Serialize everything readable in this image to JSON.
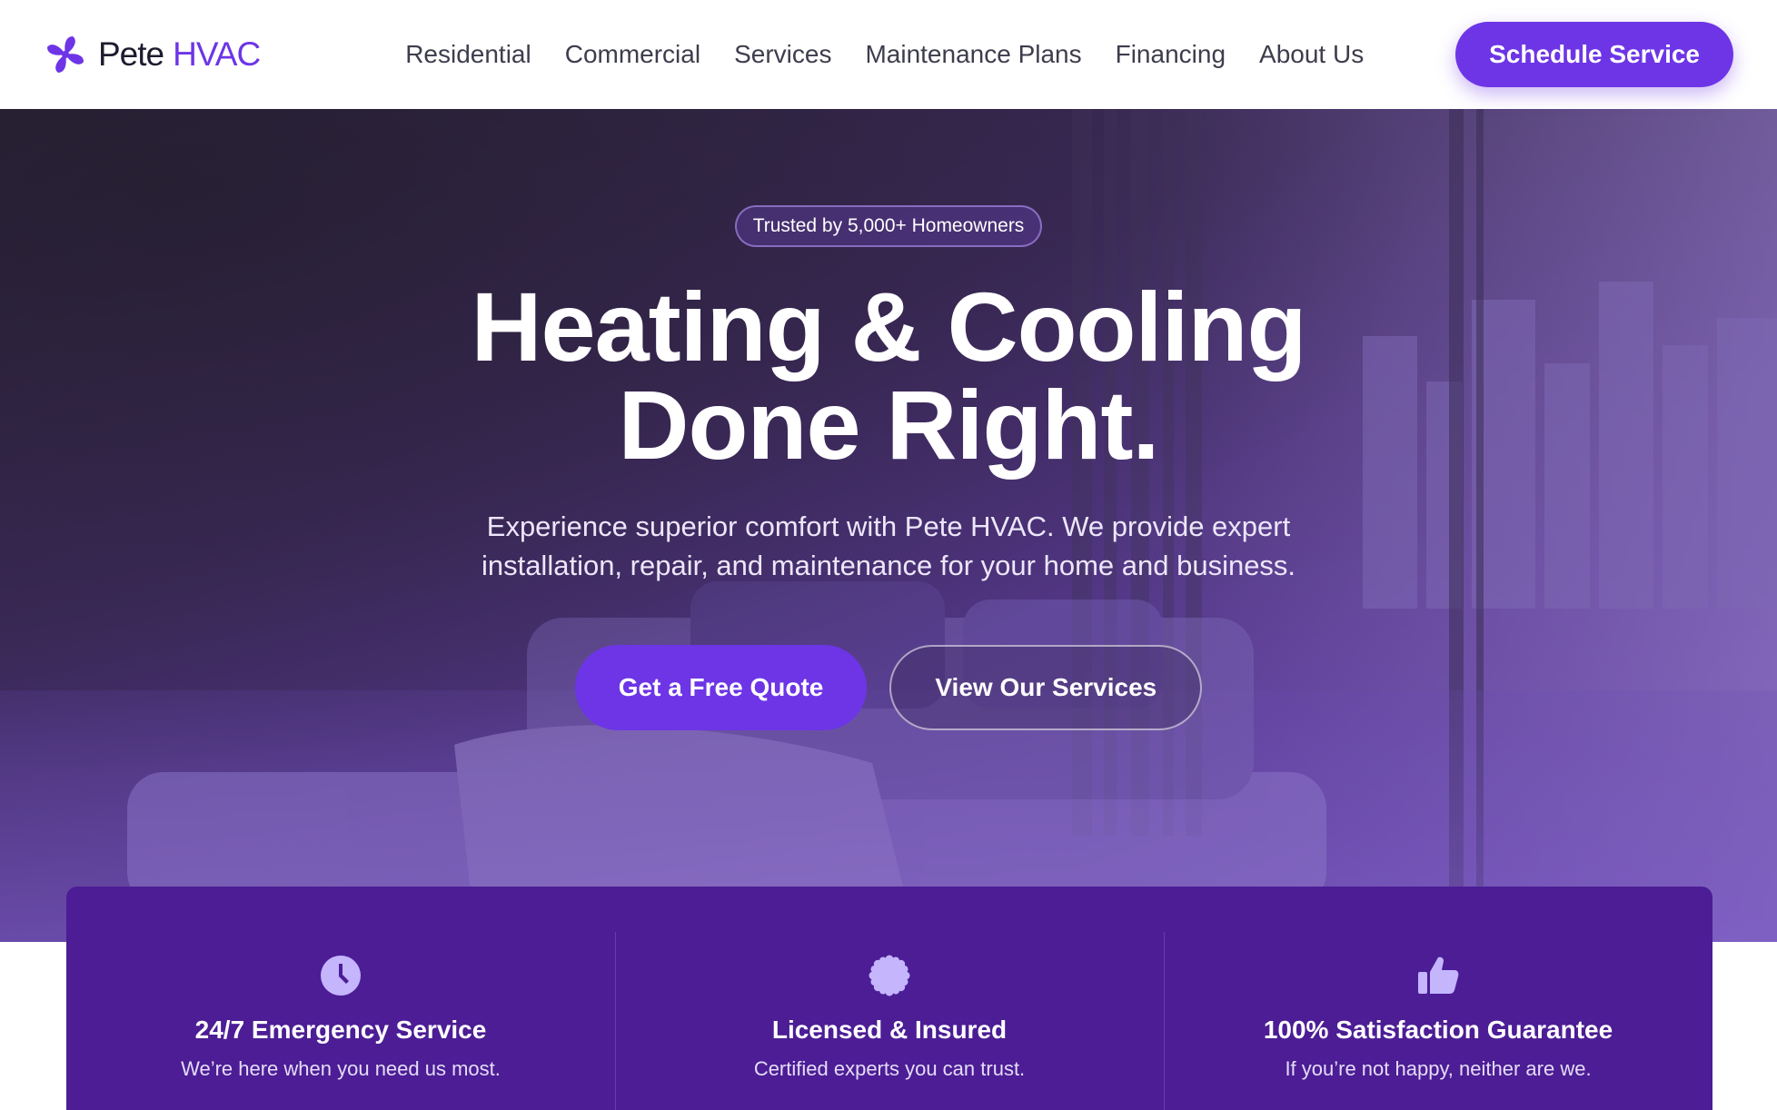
{
  "brand": {
    "name_part1": "Pete",
    "name_part2": "HVAC",
    "logo_icon": "fan-icon",
    "accent_color": "#6d35e6"
  },
  "nav": {
    "items": [
      "Residential",
      "Commercial",
      "Services",
      "Maintenance Plans",
      "Financing",
      "About Us"
    ],
    "cta_label": "Schedule Service"
  },
  "hero": {
    "badge": "Trusted by 5,000+ Homeowners",
    "title_line1": "Heating & Cooling",
    "title_line2": "Done Right.",
    "subtitle": "Experience superior comfort with Pete HVAC. We provide expert installation, repair, and maintenance for your home and business.",
    "primary_button": "Get a Free Quote",
    "secondary_button": "View Our Services"
  },
  "features": [
    {
      "icon": "clock-icon",
      "title": "24/7 Emergency Service",
      "description": "We’re here when you need us most."
    },
    {
      "icon": "badge-icon",
      "title": "Licensed & Insured",
      "description": "Certified experts you can trust."
    },
    {
      "icon": "thumbs-up-icon",
      "title": "100% Satisfaction Guarantee",
      "description": "If you’re not happy, neither are we."
    }
  ],
  "colors": {
    "primary": "#6d35e6",
    "features_bg": "#4c1d95",
    "feature_icon": "#c4b5fd"
  }
}
